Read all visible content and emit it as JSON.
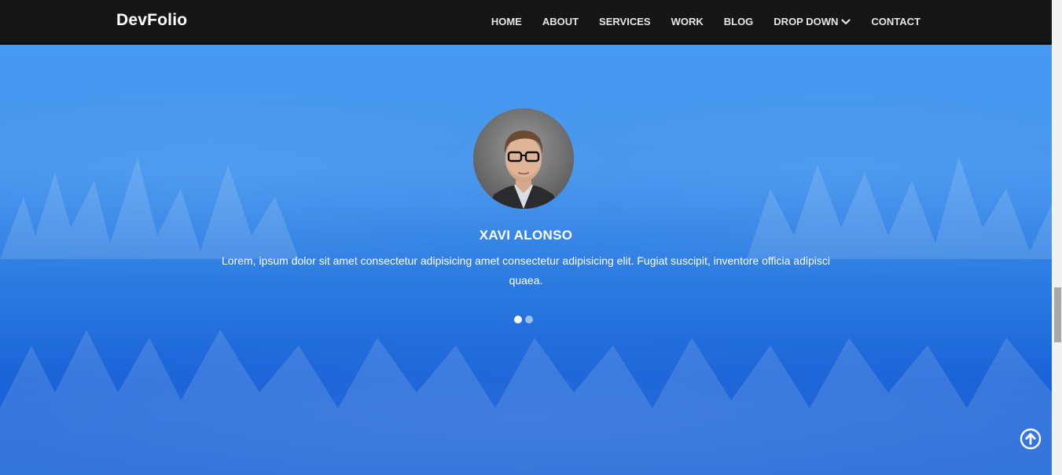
{
  "brand": "DevFolio",
  "nav": {
    "items": [
      {
        "label": "HOME"
      },
      {
        "label": "ABOUT"
      },
      {
        "label": "SERVICES"
      },
      {
        "label": "WORK"
      },
      {
        "label": "BLOG"
      },
      {
        "label": "DROP DOWN",
        "icon": "chevron-down-icon"
      },
      {
        "label": "CONTACT"
      }
    ]
  },
  "testimonial": {
    "name": "XAVI ALONSO",
    "quote": "Lorem, ipsum dolor sit amet consectetur adipisicing amet consectetur adipisicing elit. Fugiat suscipit, inventore officia adipisci quaea.",
    "active_slide": 1,
    "slide_count": 2
  },
  "back_to_top": {
    "icon": "arrow-up-circle-icon"
  },
  "colors": {
    "navbar": "#161616",
    "hero_top": "#4a9af0",
    "hero_bottom": "#1660d6",
    "text": "#ffffff"
  }
}
